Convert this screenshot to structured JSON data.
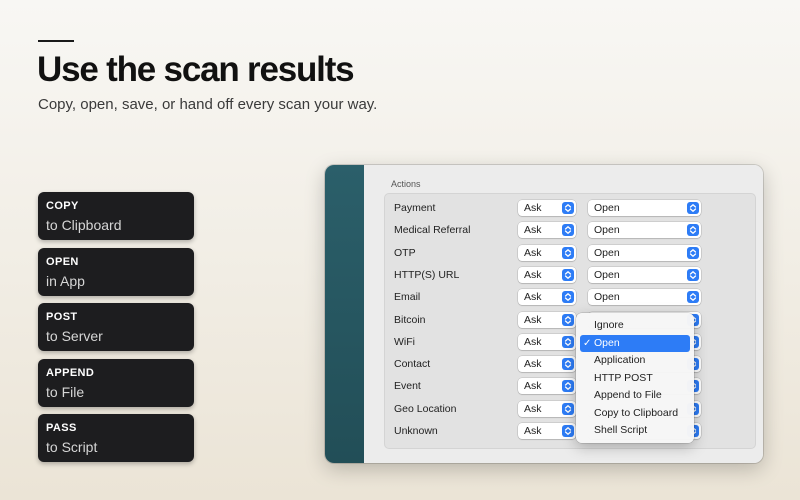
{
  "hero": {
    "title": "Use the scan results",
    "subtitle": "Copy, open, save, or hand off every scan your way."
  },
  "cards": [
    {
      "title": "COPY",
      "subtitle": "to Clipboard"
    },
    {
      "title": "OPEN",
      "subtitle": "in App"
    },
    {
      "title": "POST",
      "subtitle": "to Server"
    },
    {
      "title": "APPEND",
      "subtitle": "to File"
    },
    {
      "title": "PASS",
      "subtitle": "to Script"
    }
  ],
  "settings": {
    "section_label": "Actions",
    "rows": [
      {
        "label": "Payment",
        "ask": "Ask",
        "action": "Open"
      },
      {
        "label": "Medical Referral",
        "ask": "Ask",
        "action": "Open"
      },
      {
        "label": "OTP",
        "ask": "Ask",
        "action": "Open"
      },
      {
        "label": "HTTP(S) URL",
        "ask": "Ask",
        "action": "Open"
      },
      {
        "label": "Email",
        "ask": "Ask",
        "action": "Open"
      },
      {
        "label": "Bitcoin",
        "ask": "Ask",
        "action": ""
      },
      {
        "label": "WiFi",
        "ask": "Ask",
        "action": ""
      },
      {
        "label": "Contact",
        "ask": "Ask",
        "action": ""
      },
      {
        "label": "Event",
        "ask": "Ask",
        "action": ""
      },
      {
        "label": "Geo Location",
        "ask": "Ask",
        "action": ""
      },
      {
        "label": "Unknown",
        "ask": "Ask",
        "action": ""
      }
    ]
  },
  "dropdown_menu": {
    "selected": "Open",
    "items": [
      "Ignore",
      "Open",
      "Application",
      "HTTP POST",
      "Append to File",
      "Copy to Clipboard",
      "Shell Script"
    ]
  },
  "colors": {
    "accent": "#2d7cf6",
    "sidebar": "#2b5f6a",
    "card": "#1d1d1f"
  },
  "icons": {
    "stepper": "chevron-up-down-icon",
    "checkmark": "checkmark-icon"
  }
}
